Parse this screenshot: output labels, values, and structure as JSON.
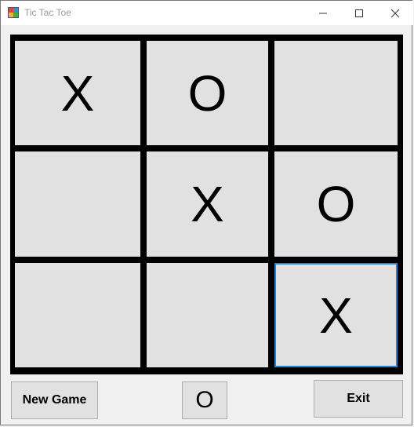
{
  "window": {
    "title": "Tic Tac Toe"
  },
  "board": {
    "cells": [
      "X",
      "O",
      "",
      "",
      "X",
      "O",
      "",
      "",
      "X"
    ],
    "focused_cell": 8
  },
  "controls": {
    "new_game_label": "New Game",
    "turn_label": "O",
    "exit_label": "Exit"
  },
  "icons": [
    "app-icon",
    "minimize-icon",
    "maximize-icon",
    "close-icon"
  ],
  "colors": {
    "grid": "#000000",
    "cell": "#e1e1e1",
    "focus": "#2f7fd1"
  }
}
